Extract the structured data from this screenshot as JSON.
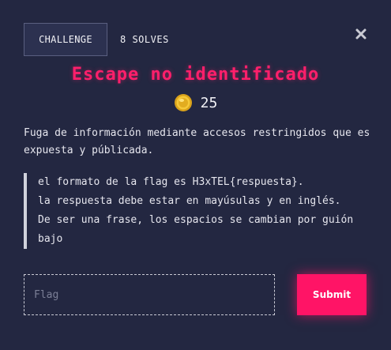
{
  "tabs": {
    "challenge_label": "CHALLENGE",
    "solves_label": "8 SOLVES"
  },
  "challenge": {
    "title": "Escape no identificado",
    "points": "25",
    "description": "Fuga de información mediante accesos restringidos que es expuesta y públicada.",
    "hint_lines": [
      "el formato de la flag es H3xTEL{respuesta}.",
      "la respuesta debe estar en mayúsulas y en inglés.",
      "De ser una frase, los espacios se cambian por guión bajo"
    ]
  },
  "form": {
    "flag_placeholder": "Flag",
    "submit_label": "Submit"
  },
  "icons": {
    "close": "close-icon",
    "coin": "coin-icon"
  },
  "colors": {
    "background": "#232741",
    "accent": "#ff1466",
    "title": "#ff1f6b"
  }
}
